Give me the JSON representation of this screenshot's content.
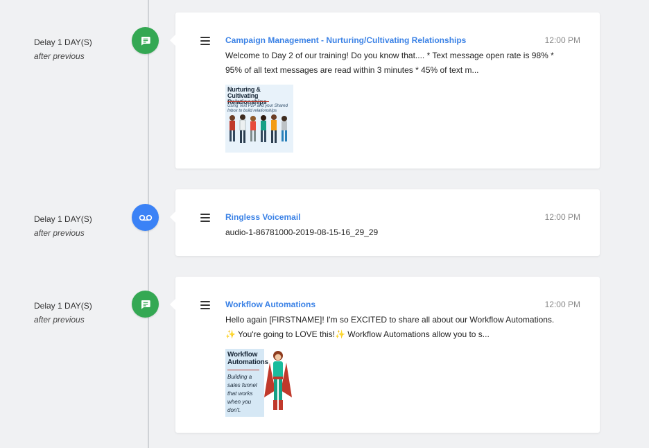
{
  "entries": [
    {
      "delay": "Delay 1 DAY(S)",
      "after": "after previous",
      "type_icon": "chat-bubble-icon",
      "color": "#34a853",
      "title": "Campaign Management - Nurturing/Cultivating Relationships",
      "time": "12:00 PM",
      "line1": "Welcome to Day 2 of our training! Do you know that.... * Text message open rate is 98% *",
      "line2": "95% of all text messages are read within 3 minutes * 45% of text m...",
      "thumb_title": "Nurturing & Cultivating Relationships",
      "thumb_sub": "Using Text P2P and your Shared Inbox to build relationships"
    },
    {
      "delay": "Delay 1 DAY(S)",
      "after": "after previous",
      "type_icon": "voicemail-icon",
      "color": "#3b82f6",
      "title": "Ringless Voicemail",
      "time": "12:00 PM",
      "line1": "audio-1-86781000-2019-08-15-16_29_29"
    },
    {
      "delay": "Delay 1 DAY(S)",
      "after": "after previous",
      "type_icon": "chat-bubble-icon",
      "color": "#34a853",
      "title": "Workflow Automations",
      "time": "12:00 PM",
      "line1": "Hello again [FIRSTNAME]! I'm so EXCITED to share all about our Workflow Automations.",
      "line2": "✨ You're going to LOVE this!✨ Workflow Automations allow you to s...",
      "thumb_title": "Workflow Automations",
      "thumb_sub": "Building a sales funnel that works when you don't."
    }
  ]
}
